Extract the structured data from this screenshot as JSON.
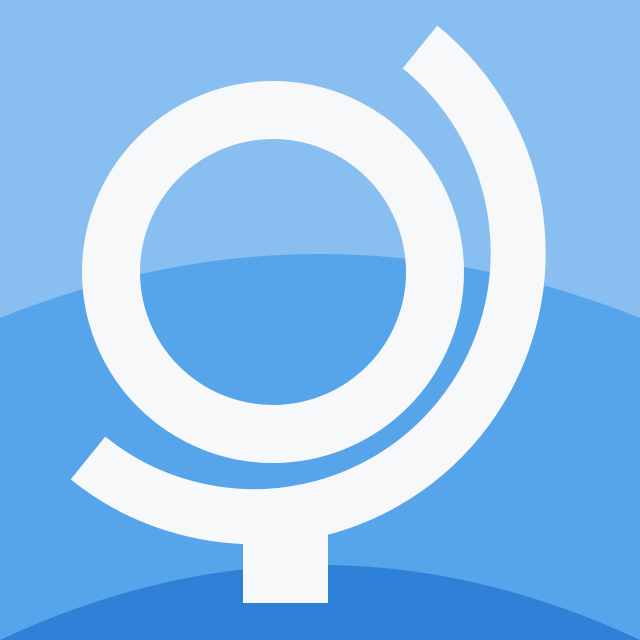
{
  "icon": {
    "name": "globe-icon",
    "colors": {
      "sky": "#88bff0",
      "middle_band": "#56a4ea",
      "base_band": "#2e81d6",
      "glyph": "#f7f8fa"
    }
  }
}
